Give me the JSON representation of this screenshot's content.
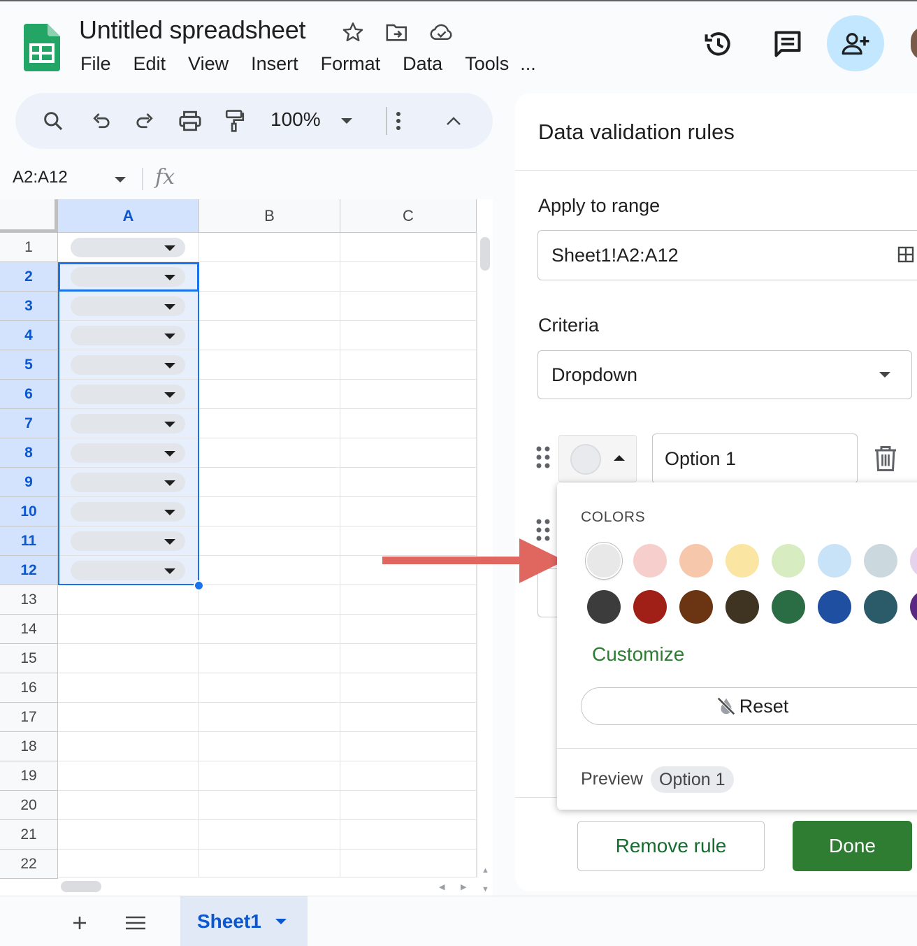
{
  "app": {
    "title": "Untitled spreadsheet",
    "menu": [
      "File",
      "Edit",
      "View",
      "Insert",
      "Format",
      "Data",
      "Tools",
      "..."
    ]
  },
  "toolbar": {
    "zoom": "100%"
  },
  "formula_bar": {
    "name_box": "A2:A12",
    "fx_symbol": "fx"
  },
  "grid": {
    "columns": [
      "A",
      "B",
      "C"
    ],
    "rows": [
      "1",
      "2",
      "3",
      "4",
      "5",
      "6",
      "7",
      "8",
      "9",
      "10",
      "11",
      "12",
      "13",
      "14",
      "15",
      "16",
      "17",
      "18",
      "19",
      "20",
      "21",
      "22"
    ],
    "selected_rows": [
      "2",
      "3",
      "4",
      "5",
      "6",
      "7",
      "8",
      "9",
      "10",
      "11",
      "12"
    ],
    "dropdown_rows": [
      "1",
      "2",
      "3",
      "4",
      "5",
      "6",
      "7",
      "8",
      "9",
      "10",
      "11",
      "12"
    ]
  },
  "sheet_tabs": {
    "active": "Sheet1"
  },
  "panel": {
    "title": "Data validation rules",
    "apply_label": "Apply to range",
    "range_value": "Sheet1!A2:A12",
    "criteria_label": "Criteria",
    "criteria_value": "Dropdown",
    "option1_value": "Option 1",
    "remove_label": "Remove rule",
    "done_label": "Done"
  },
  "color_popup": {
    "section_label": "COLORS",
    "light_colors": [
      "#e8e8e8",
      "#f6cfcc",
      "#f6c7ab",
      "#fbe5a2",
      "#d8ecc2",
      "#c8e2f7",
      "#cbd9df",
      "#e5d3ee"
    ],
    "dark_colors": [
      "#3c3c3c",
      "#a01f17",
      "#6b3513",
      "#3f3322",
      "#2a6c44",
      "#1f4fa0",
      "#2b5a68",
      "#5a2a82"
    ],
    "selected_index": 0,
    "customize_label": "Customize",
    "reset_label": "Reset",
    "preview_label": "Preview",
    "preview_chip": "Option 1"
  },
  "annotation": {
    "arrow_color": "#e06660"
  },
  "colors": {
    "accent_blue": "#1a73e8",
    "sheets_green": "#2e7d32",
    "share_bg": "#c2e7ff"
  }
}
